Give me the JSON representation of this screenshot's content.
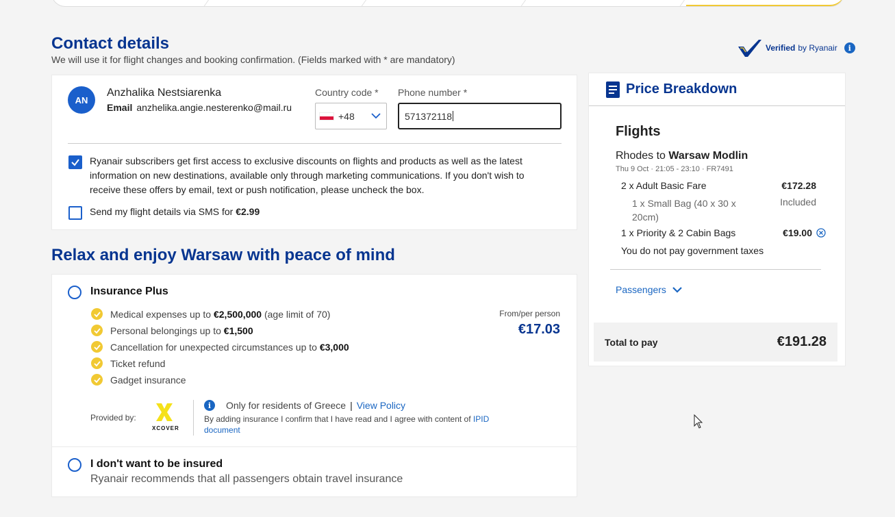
{
  "contact": {
    "title": "Contact details",
    "subtitle": "We will use it for flight changes and booking confirmation. (Fields marked with * are mandatory)",
    "verified_prefix": "Verified",
    "verified_suffix": "by Ryanair",
    "avatar_initials": "AN",
    "name": "Anzhalika Nestsiarenka",
    "email_label": "Email",
    "email": "anzhelika.angie.nesterenko@mail.ru",
    "country_code_label": "Country code *",
    "country_code_value": "+48",
    "phone_label": "Phone number *",
    "phone_value": "571372118",
    "subscribe_checked": true,
    "subscribe_text": "Ryanair subscribers get first access to exclusive discounts on flights and products as well as the latest information on new destinations, available only through marketing communications. If you don't wish to receive these offers by email, text or push notification, please uncheck the box.",
    "sms_checked": false,
    "sms_text": "Send my flight details via SMS for",
    "sms_price": "€2.99"
  },
  "insurance": {
    "title": "Relax and enjoy Warsaw with peace of mind",
    "plus": {
      "title": "Insurance Plus",
      "from_label": "From/per person",
      "price": "€17.03",
      "features": [
        {
          "text": "Medical expenses up to",
          "bold": "€2,500,000",
          "suffix": "(age limit of 70)"
        },
        {
          "text": "Personal belongings up to",
          "bold": "€1,500",
          "suffix": ""
        },
        {
          "text": "Cancellation for unexpected circumstances up to",
          "bold": "€3,000",
          "suffix": ""
        },
        {
          "text": "Ticket refund",
          "bold": "",
          "suffix": ""
        },
        {
          "text": "Gadget insurance",
          "bold": "",
          "suffix": ""
        }
      ],
      "provided_by": "Provided by:",
      "provider_logo_text": "XCOVER",
      "residents_text": "Only for residents of Greece",
      "separator": "|",
      "view_policy": "View Policy",
      "disclaimer": "By adding insurance I confirm that I have read and I agree with content of",
      "ipid_link": "IPID document"
    },
    "none": {
      "title": "I don't want to be insured",
      "subtitle": "Ryanair recommends that all passengers obtain travel insurance"
    }
  },
  "price_breakdown": {
    "title": "Price Breakdown",
    "flights_heading": "Flights",
    "route_from": "Rhodes to",
    "route_to": "Warsaw Modlin",
    "meta": "Thu 9 Oct  ·  21:05 - 23:10  ·  FR7491",
    "lines": {
      "fare_label": "2 x Adult Basic Fare",
      "fare_value": "€172.28",
      "bag_label": "1 x Small Bag (40 x 30 x 20cm)",
      "bag_value": "Included",
      "priority_label": "1 x Priority & 2 Cabin Bags",
      "priority_value": "€19.00",
      "tax_note": "You do not pay government taxes"
    },
    "passengers_label": "Passengers",
    "total_label": "Total to pay",
    "total_value": "€191.28"
  },
  "colors": {
    "brand_blue": "#073590",
    "link_blue": "#1a66c2",
    "accent_yellow": "#f1c933"
  }
}
